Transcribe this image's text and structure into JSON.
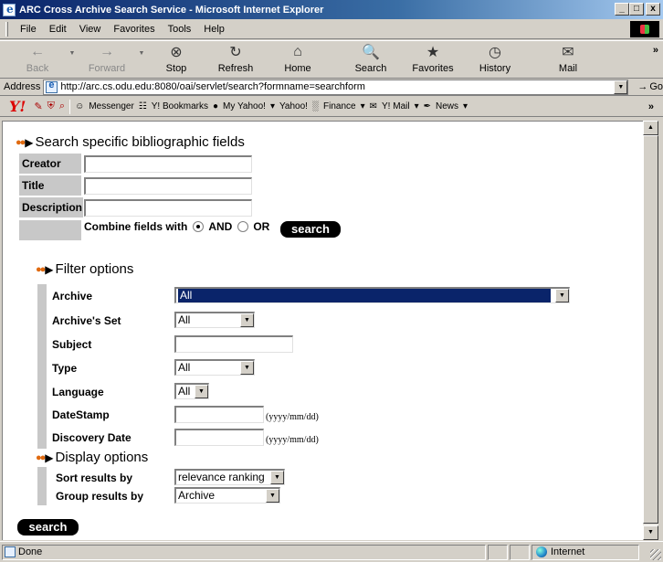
{
  "window": {
    "title": "ARC Cross Archive Search Service - Microsoft Internet Explorer",
    "min_glyph": "_",
    "max_glyph": "□",
    "close_glyph": "x"
  },
  "menu": [
    "File",
    "Edit",
    "View",
    "Favorites",
    "Tools",
    "Help"
  ],
  "toolbar": {
    "back": "Back",
    "forward": "Forward",
    "stop": "Stop",
    "refresh": "Refresh",
    "home": "Home",
    "search": "Search",
    "favorites": "Favorites",
    "history": "History",
    "mail": "Mail"
  },
  "address": {
    "label": "Address",
    "url": "http://arc.cs.odu.edu:8080/oai/servlet/search?formname=searchform",
    "go": "Go"
  },
  "yahoo_bar": {
    "messenger": "Messenger",
    "bookmarks": "Y! Bookmarks",
    "my_yahoo": "My Yahoo!",
    "yahoo": "Yahoo!",
    "finance": "Finance",
    "mail": "Y! Mail",
    "news": "News"
  },
  "search_fields": {
    "title": "Search specific bibliographic fields",
    "creator_label": "Creator",
    "title_label": "Title",
    "description_label": "Description",
    "combine_label": "Combine fields with",
    "and_label": "AND",
    "or_label": "OR",
    "search_button": "search"
  },
  "filter": {
    "title": "Filter options",
    "archive_label": "Archive",
    "archive_value": "All",
    "set_label": "Archive's Set",
    "set_value": "All",
    "subject_label": "Subject",
    "type_label": "Type",
    "type_value": "All",
    "language_label": "Language",
    "language_value": "All",
    "datestamp_label": "DateStamp",
    "date_hint": "(yyyy/mm/dd)",
    "discovery_label": "Discovery Date",
    "discovery_hint": "(yyyy/mm/dd)"
  },
  "display": {
    "title": "Display options",
    "sort_label": "Sort results by",
    "sort_value": "relevance ranking",
    "group_label": "Group results by",
    "group_value": "Archive",
    "search_button": "search"
  },
  "status": {
    "text": "Done",
    "zone": "Internet"
  }
}
